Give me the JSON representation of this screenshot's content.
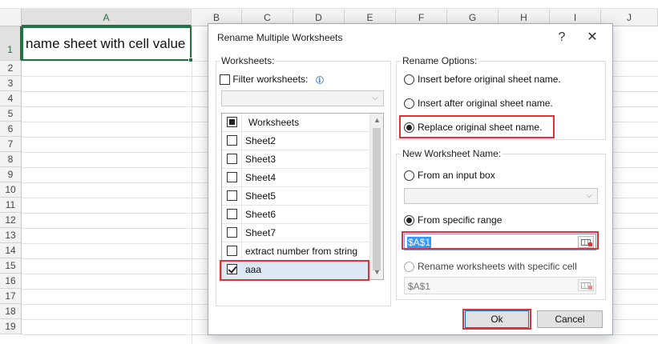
{
  "spreadsheet": {
    "columns": [
      "A",
      "B",
      "C",
      "D",
      "E",
      "F",
      "G",
      "H",
      "I",
      "J"
    ],
    "rows": [
      "1",
      "2",
      "3",
      "4",
      "5",
      "6",
      "7",
      "8",
      "9",
      "10",
      "11",
      "12",
      "13",
      "14",
      "15",
      "16",
      "17",
      "18",
      "19"
    ],
    "cell_a1_value": "name sheet with cell value",
    "selected_cell": "A1",
    "accent_color": "#217346"
  },
  "dialog": {
    "title": "Rename Multiple Worksheets",
    "help_label": "?",
    "close_label": "✕",
    "worksheets_group_label": "Worksheets:",
    "filter_label": "Filter worksheets:",
    "filter_checked": false,
    "info_icon": "info-icon",
    "list_header": "Worksheets",
    "list_items": [
      {
        "label": "Sheet2",
        "checked": false
      },
      {
        "label": "Sheet3",
        "checked": false
      },
      {
        "label": "Sheet4",
        "checked": false
      },
      {
        "label": "Sheet5",
        "checked": false
      },
      {
        "label": "Sheet6",
        "checked": false
      },
      {
        "label": "Sheet7",
        "checked": false
      },
      {
        "label": "extract number from string",
        "checked": false
      },
      {
        "label": "aaa",
        "checked": true
      }
    ],
    "rename_options_label": "Rename Options:",
    "rename_options": [
      {
        "label": "Insert before original sheet name.",
        "selected": false
      },
      {
        "label": "Insert after original sheet name.",
        "selected": false
      },
      {
        "label": "Replace original sheet name.",
        "selected": true
      }
    ],
    "new_name_label": "New Worksheet Name:",
    "from_input_box_label": "From an input box",
    "from_range_label": "From specific range",
    "range_value": "$A$1",
    "specific_cell_label": "Rename worksheets with specific cell",
    "specific_cell_value": "$A$1",
    "ok_label": "Ok",
    "cancel_label": "Cancel",
    "highlight_color": "#e03232"
  }
}
